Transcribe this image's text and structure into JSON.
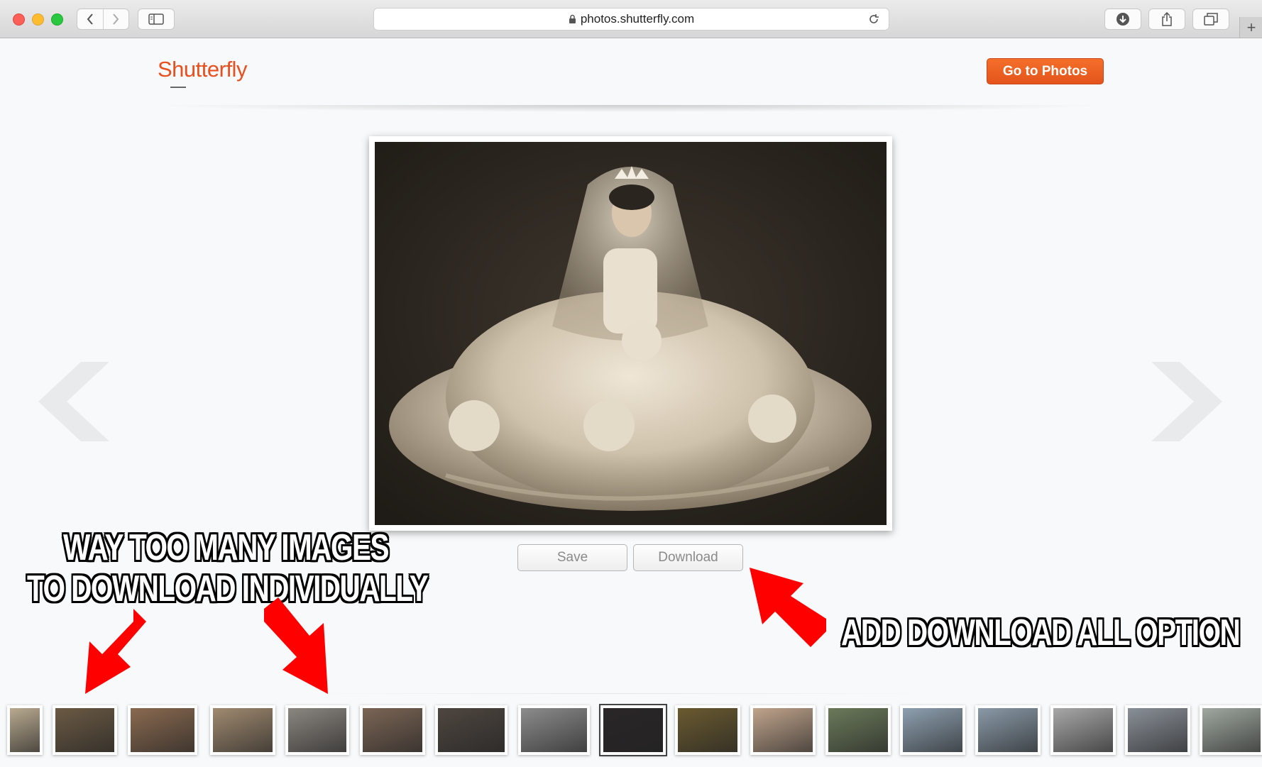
{
  "browser": {
    "url": "photos.shutterfly.com",
    "icons": [
      "back-icon",
      "forward-icon",
      "sidebar-icon",
      "lock-icon",
      "reload-icon",
      "download-icon",
      "share-icon",
      "tabs-icon",
      "plus-icon"
    ],
    "new_tab_label": "+"
  },
  "header": {
    "logo": "Shutterfly",
    "go_to_photos": "Go to Photos"
  },
  "viewer": {
    "save_label": "Save",
    "download_label": "Download"
  },
  "annotations": {
    "line1": "WAY TOO MANY IMAGES",
    "line2": "TO DOWNLOAD INDIVIDUALLY",
    "line3": "ADD DOWNLOAD ALL OPTION"
  },
  "colors": {
    "brand": "#e8501f",
    "annotation_arrow": "#ff0000"
  },
  "thumbnails": [
    {
      "tone": "#b9aa90"
    },
    {
      "tone": "#6b5a44"
    },
    {
      "tone": "#8a6a50"
    },
    {
      "tone": "#a08a70"
    },
    {
      "tone": "#8b8680"
    },
    {
      "tone": "#7b6555"
    },
    {
      "tone": "#4e4640"
    },
    {
      "tone": "#8c8c8c"
    },
    {
      "tone": "#2a2628"
    },
    {
      "tone": "#6a5a30"
    },
    {
      "tone": "#c0a48c"
    },
    {
      "tone": "#6b7a5a"
    },
    {
      "tone": "#8ea0b0"
    },
    {
      "tone": "#8a9aa8"
    },
    {
      "tone": "#a8a8a8"
    },
    {
      "tone": "#8a9098"
    },
    {
      "tone": "#a0a8a0"
    }
  ]
}
